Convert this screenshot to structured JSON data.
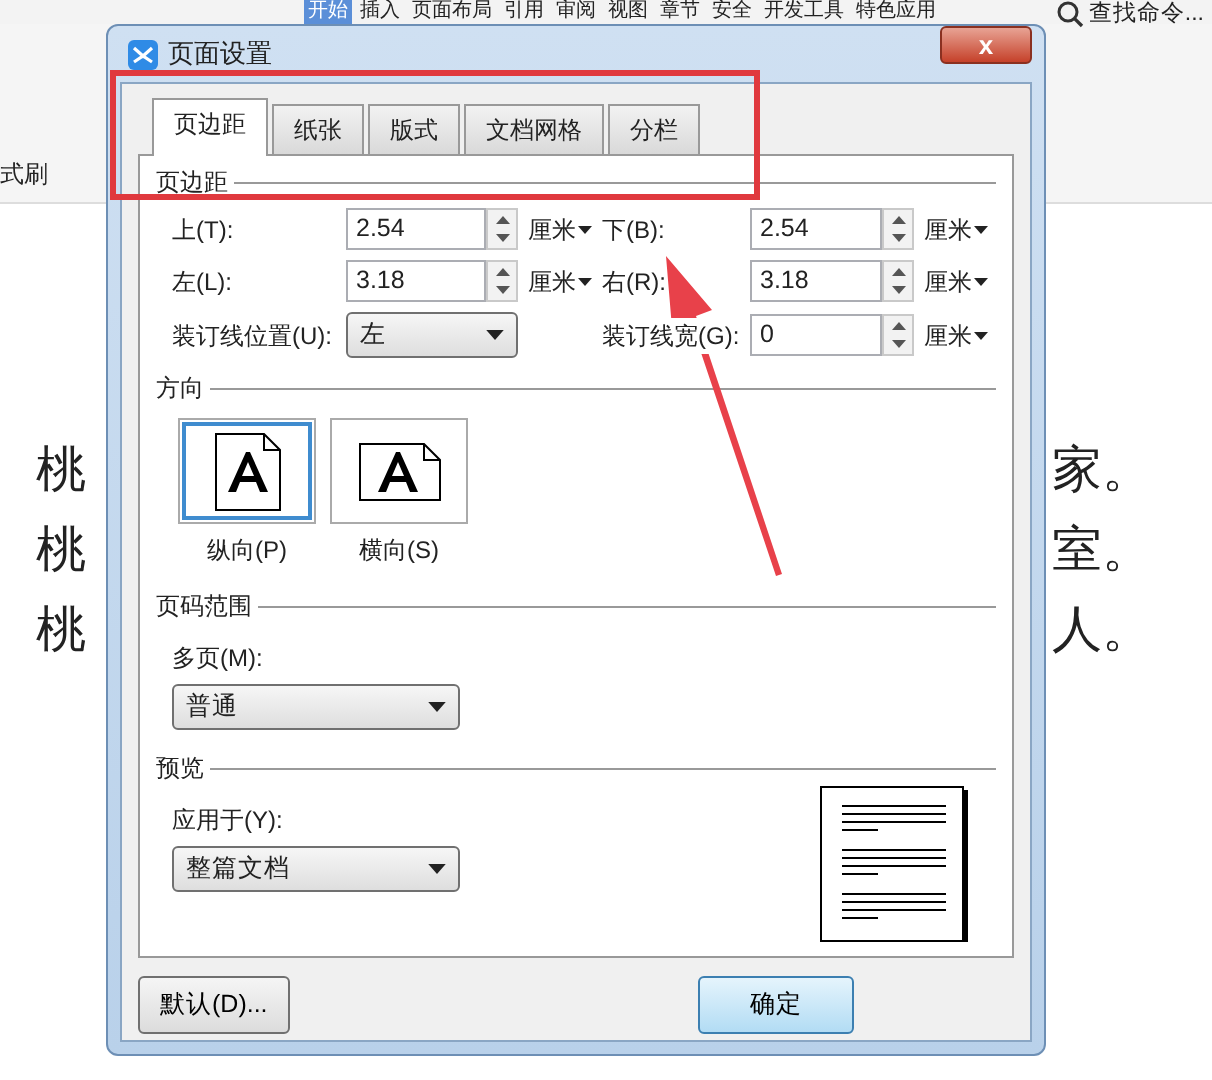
{
  "app": {
    "menu_tabs": [
      {
        "label": "开始",
        "selected": true
      },
      {
        "label": "插入",
        "selected": false
      },
      {
        "label": "页面布局",
        "selected": false
      },
      {
        "label": "引用",
        "selected": false
      },
      {
        "label": "审阅",
        "selected": false
      },
      {
        "label": "视图",
        "selected": false
      },
      {
        "label": "章节",
        "selected": false
      },
      {
        "label": "安全",
        "selected": false
      },
      {
        "label": "开发工具",
        "selected": false
      },
      {
        "label": "特色应用",
        "selected": false
      }
    ],
    "search": "查找命令...",
    "toolbar_label": "式刷",
    "document_lines": [
      {
        "left": "桃",
        "right": "家。"
      },
      {
        "left": "桃",
        "right": "室。"
      },
      {
        "left": "桃",
        "right": "人。"
      }
    ]
  },
  "dialog": {
    "title": "页面设置",
    "close_label": "x",
    "tabs": [
      {
        "label": "页边距",
        "selected": true
      },
      {
        "label": "纸张",
        "selected": false
      },
      {
        "label": "版式",
        "selected": false
      },
      {
        "label": "文档网格",
        "selected": false
      },
      {
        "label": "分栏",
        "selected": false
      }
    ],
    "margins": {
      "heading": "页边距",
      "fields": [
        {
          "label": "上(T):",
          "value": "2.54",
          "unit": "厘米"
        },
        {
          "label": "下(B):",
          "value": "2.54",
          "unit": "厘米"
        },
        {
          "label": "左(L):",
          "value": "3.18",
          "unit": "厘米"
        },
        {
          "label": "右(R):",
          "value": "3.18",
          "unit": "厘米"
        }
      ],
      "gutter_position": {
        "label": "装订线位置(U):",
        "value": "左"
      },
      "gutter": {
        "label": "装订线宽(G):",
        "value": "0",
        "unit": "厘米"
      }
    },
    "orientation": {
      "heading": "方向",
      "options": [
        {
          "label": "纵向(P)",
          "selected": true,
          "kind": "portrait"
        },
        {
          "label": "横向(S)",
          "selected": false,
          "kind": "landscape"
        }
      ]
    },
    "page_range": {
      "heading": "页码范围",
      "label": "多页(M):",
      "value": "普通"
    },
    "preview": {
      "heading": "预览",
      "label": "应用于(Y):",
      "value": "整篇文档"
    },
    "buttons": [
      {
        "label": "默认(D)...",
        "kind": "secondary"
      },
      {
        "label": "确定",
        "kind": "primary"
      }
    ]
  }
}
